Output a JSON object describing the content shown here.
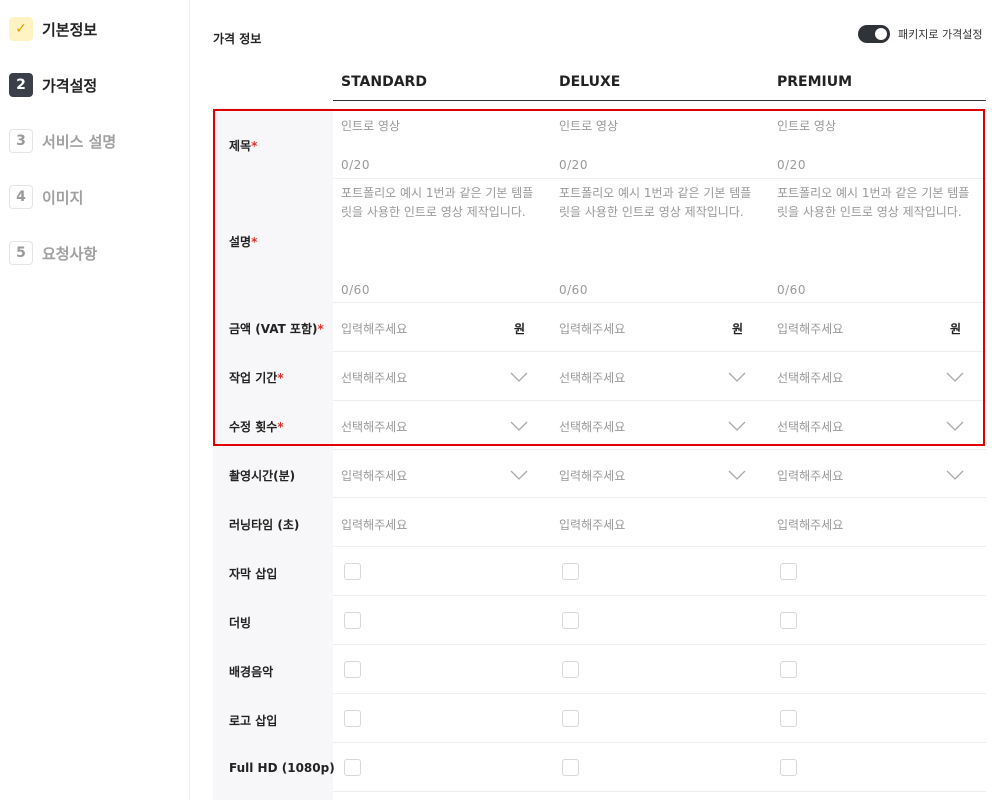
{
  "sidebar": {
    "steps": [
      {
        "num": "✓",
        "label": "기본정보"
      },
      {
        "num": "2",
        "label": "가격설정"
      },
      {
        "num": "3",
        "label": "서비스 설명"
      },
      {
        "num": "4",
        "label": "이미지"
      },
      {
        "num": "5",
        "label": "요청사항"
      }
    ]
  },
  "main": {
    "section_title": "가격 정보",
    "toggle_label": "패키지로 가격설정",
    "toggle_on": true,
    "packages": [
      "STANDARD",
      "DELUXE",
      "PREMIUM"
    ],
    "rows": {
      "title": {
        "label": "제목",
        "required": "*",
        "placeholder": "인트로 영상",
        "counter": "0/20"
      },
      "description": {
        "label": "설명",
        "required": "*",
        "placeholder": "포트폴리오 예시 1번과 같은 기본 템플릿을 사용한 인트로 영상 제작입니다.",
        "counter": "0/60"
      },
      "price": {
        "label": "금액 (VAT 포함)",
        "required": "*",
        "placeholder": "입력해주세요",
        "unit": "원"
      },
      "work_period": {
        "label": "작업 기간",
        "required": "*",
        "placeholder": "선택해주세요"
      },
      "revisions": {
        "label": "수정 횟수",
        "required": "*",
        "placeholder": "선택해주세요"
      },
      "shoot_time": {
        "label": "촬영시간(분)",
        "placeholder": "입력해주세요"
      },
      "running_time": {
        "label": "러닝타임 (초)",
        "placeholder": "입력해주세요"
      },
      "subtitles": {
        "label": "자막 삽입"
      },
      "dubbing": {
        "label": "더빙"
      },
      "bgm": {
        "label": "배경음악"
      },
      "logo": {
        "label": "로고 삽입"
      },
      "fullhd": {
        "label": "Full HD (1080p)"
      }
    }
  },
  "colors": {
    "highlight": "#e00000",
    "toggle": "#2f3237",
    "required": "#e5312c"
  }
}
